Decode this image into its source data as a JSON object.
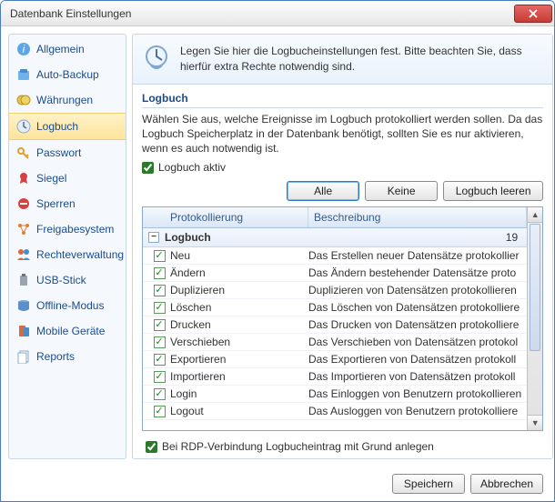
{
  "window": {
    "title": "Datenbank Einstellungen"
  },
  "sidebar": {
    "items": [
      {
        "label": "Allgemein"
      },
      {
        "label": "Auto-Backup"
      },
      {
        "label": "Währungen"
      },
      {
        "label": "Logbuch"
      },
      {
        "label": "Passwort"
      },
      {
        "label": "Siegel"
      },
      {
        "label": "Sperren"
      },
      {
        "label": "Freigabesystem"
      },
      {
        "label": "Rechteverwaltung"
      },
      {
        "label": "USB-Stick"
      },
      {
        "label": "Offline-Modus"
      },
      {
        "label": "Mobile Geräte"
      },
      {
        "label": "Reports"
      }
    ]
  },
  "banner": {
    "text": "Legen Sie hier die Logbucheinstellungen fest. Bitte beachten Sie, dass hierfür extra Rechte notwendig sind."
  },
  "section": {
    "title": "Logbuch",
    "desc": "Wählen Sie aus, welche Ereignisse im Logbuch protokolliert werden sollen. Da das Logbuch Speicherplatz in der Datenbank benötigt, sollten Sie es nur aktivieren, wenn es auch notwendig ist.",
    "active_label": "Logbuch aktiv"
  },
  "buttons": {
    "all": "Alle",
    "none": "Keine",
    "clear": "Logbuch leeren",
    "save": "Speichern",
    "cancel": "Abbrechen"
  },
  "grid": {
    "col_protocol": "Protokollierung",
    "col_desc": "Beschreibung",
    "group_label": "Logbuch",
    "group_count": "19",
    "rows": [
      {
        "name": "Neu",
        "desc": "Das Erstellen neuer Datensätze protokollier"
      },
      {
        "name": "Ändern",
        "desc": "Das Ändern bestehender Datensätze proto"
      },
      {
        "name": "Duplizieren",
        "desc": "Duplizieren von Datensätzen protokollieren"
      },
      {
        "name": "Löschen",
        "desc": "Das Löschen von Datensätzen protokolliere"
      },
      {
        "name": "Drucken",
        "desc": "Das Drucken von Datensätzen protokolliere"
      },
      {
        "name": "Verschieben",
        "desc": "Das Verschieben von Datensätzen protokol"
      },
      {
        "name": "Exportieren",
        "desc": "Das Exportieren von Datensätzen protokoll"
      },
      {
        "name": "Importieren",
        "desc": "Das Importieren von Datensätzen protokoll"
      },
      {
        "name": "Login",
        "desc": "Das Einloggen von Benutzern protokollieren"
      },
      {
        "name": "Logout",
        "desc": "Das Ausloggen von Benutzern protokolliere"
      }
    ]
  },
  "rdp": {
    "label": "Bei RDP-Verbindung Logbucheintrag mit Grund anlegen"
  }
}
